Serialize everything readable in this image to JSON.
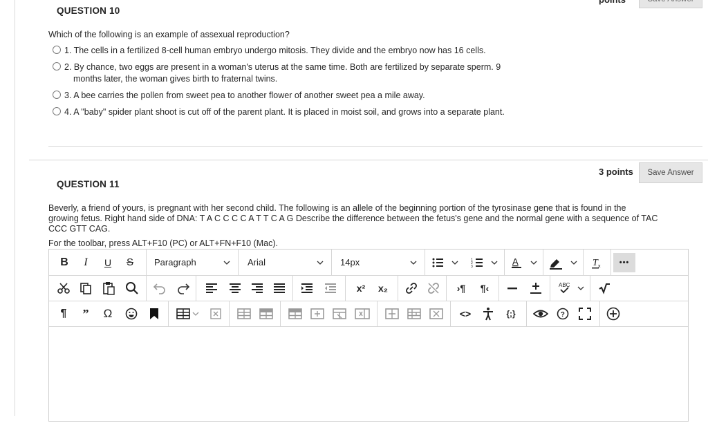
{
  "q10": {
    "title": "QUESTION 10",
    "points_label_partial": "points",
    "save_label_partial": "Save Answer",
    "prompt": "Which of the following is an example of assexual reproduction?",
    "options": [
      {
        "line1": "1. The cells in a fertilized 8-cell human embryo undergo mitosis. They divide and the embryo now has 16 cells."
      },
      {
        "line1": "2. By chance, two eggs are present in a woman's uterus at the same time.  Both are fertilized by separate sperm.  9",
        "line2": "months later, the woman gives birth to fraternal twins."
      },
      {
        "line1": "3. A bee carries the pollen from sweet pea to another flower of another sweet pea a mile away."
      },
      {
        "line1": "4. A \"baby\" spider plant shoot is cut off of the parent plant.  It is placed in moist soil, and grows into a separate plant."
      }
    ]
  },
  "q11": {
    "title": "QUESTION 11",
    "points": "3 points",
    "save_label": "Save Answer",
    "prompt_line1": "Beverly, a friend of yours, is pregnant with her second child.  The following is an allele of the beginning portion of the tyrosinase gene that is found in the",
    "prompt_line2": "growing fetus.  Right hand side of DNA: T A C C C C A T T C A G Describe the difference between the fetus's gene and the normal gene with  a sequence of  TAC",
    "prompt_line3": "CCC  GTT CAG.",
    "toolbar_hint": "For the toolbar, press ALT+F10 (PC) or ALT+FN+F10 (Mac)."
  },
  "editor": {
    "bold": "B",
    "italic": "I",
    "underline": "U",
    "strike": "S",
    "paragraph": "Paragraph",
    "font": "Arial",
    "size": "14px",
    "more": "•••",
    "superscript": "x²",
    "subscript": "x₂"
  }
}
